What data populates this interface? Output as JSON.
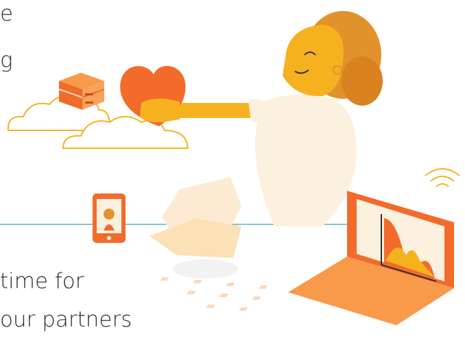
{
  "text": {
    "line1": "e",
    "line2": "g",
    "line3": "time for",
    "line4": "our partners"
  },
  "colors": {
    "orange": "#f26b2b",
    "orange_light": "#f89a4a",
    "yellow": "#f6b11f",
    "cream": "#fcf1df",
    "cloud_stroke": "#f6b11f",
    "line": "#7fc8cf",
    "text": "#2a2f36"
  },
  "icons": [
    "server-icon",
    "heart-icon",
    "cloud-icon",
    "phone-icon",
    "laptop-icon",
    "wifi-icon",
    "paper-icon",
    "chart-icon"
  ]
}
